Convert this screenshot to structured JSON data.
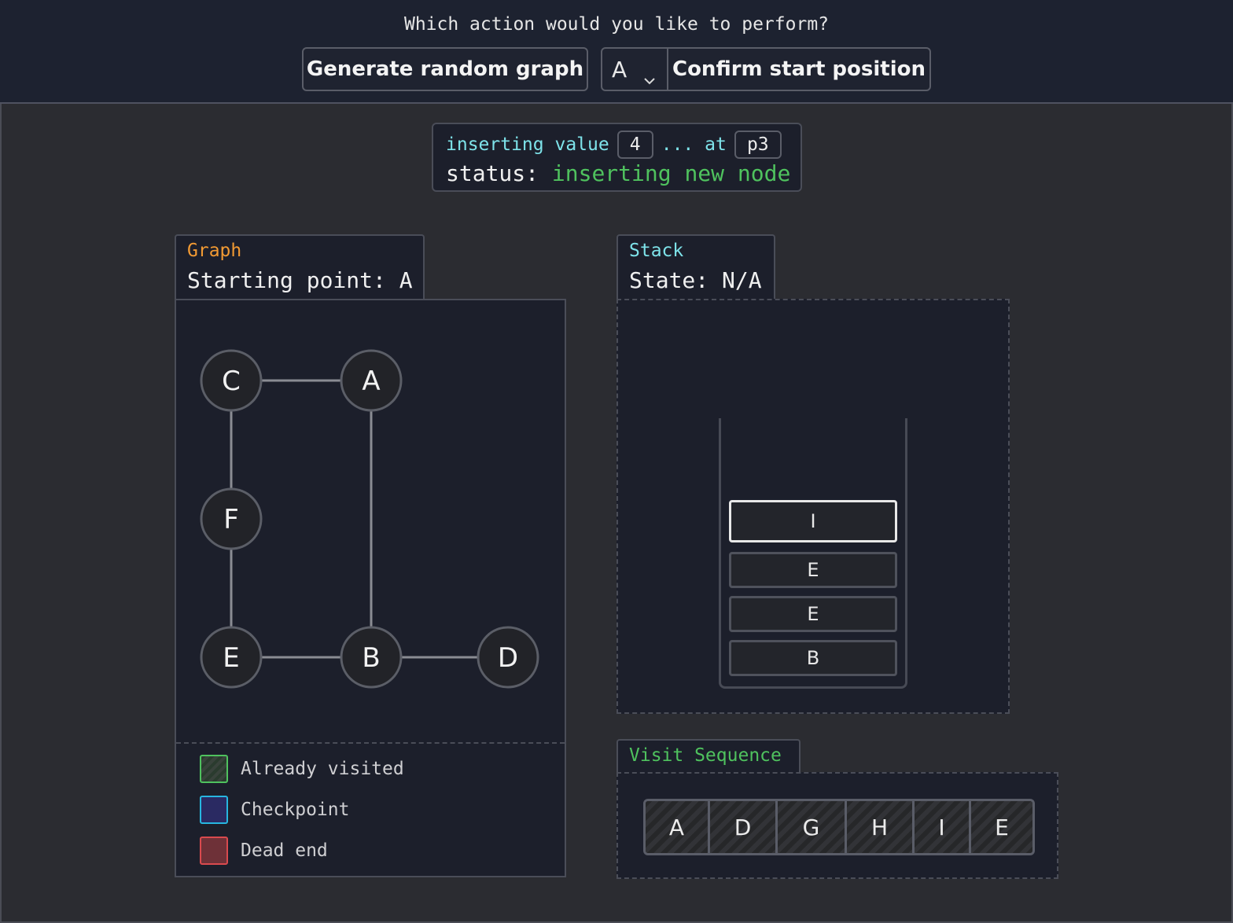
{
  "header": {
    "prompt": "Which action would you like to perform?",
    "generate_label": "Generate random graph",
    "start_select_value": "A",
    "confirm_label": "Confirm start position"
  },
  "status": {
    "inserting_label": "inserting value",
    "value": "4",
    "at_label": "... at",
    "position": "p3",
    "status_label": "status:",
    "status_value": "inserting new node"
  },
  "graph": {
    "tab_title": "Graph",
    "starting_point": "Starting point: A",
    "nodes": [
      {
        "id": "C",
        "col": 0,
        "row": 0
      },
      {
        "id": "A",
        "col": 1,
        "row": 0
      },
      {
        "id": "F",
        "col": 0,
        "row": 1
      },
      {
        "id": "E",
        "col": 0,
        "row": 2
      },
      {
        "id": "B",
        "col": 1,
        "row": 2
      },
      {
        "id": "D",
        "col": 2,
        "row": 2
      }
    ],
    "edges": [
      [
        "C",
        "A"
      ],
      [
        "C",
        "F"
      ],
      [
        "F",
        "E"
      ],
      [
        "A",
        "B"
      ],
      [
        "E",
        "B"
      ],
      [
        "B",
        "D"
      ]
    ],
    "legend": [
      {
        "label": "Already visited",
        "kind": "visited"
      },
      {
        "label": "Checkpoint",
        "kind": "checkpoint"
      },
      {
        "label": "Dead end",
        "kind": "dead-end"
      }
    ]
  },
  "stack": {
    "tab_title": "Stack",
    "state": "State: N/A",
    "items": [
      "I",
      "E",
      "E",
      "B"
    ]
  },
  "visit": {
    "tab_title": "Visit Sequence",
    "sequence": [
      "A",
      "D",
      "G",
      "H",
      "I",
      "E"
    ]
  },
  "colors": {
    "accent_graph": "#f29a33",
    "accent_stack": "#7ee3ea",
    "accent_visit": "#4fc25e"
  }
}
